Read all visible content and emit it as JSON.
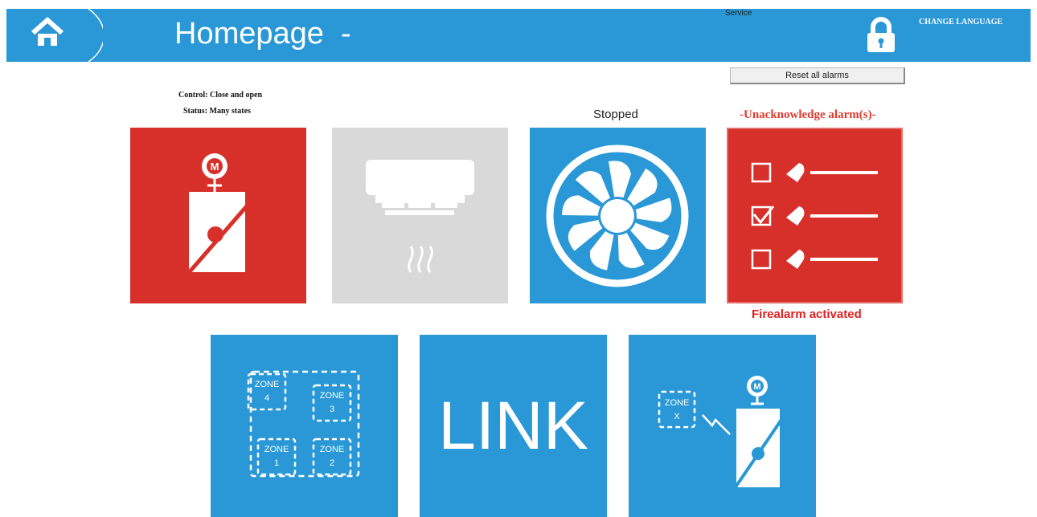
{
  "header": {
    "title": "Homepage  -",
    "service_label": "Service",
    "change_language": "CHANGE LANGUAGE",
    "color": "#2a98d6"
  },
  "toolbar": {
    "reset_alarms": "Reset all alarms"
  },
  "damper": {
    "control_label": "Control:",
    "control_value": "Close and open",
    "status_label": "Status:",
    "status_value": "Many states",
    "motor_letter": "M"
  },
  "fan": {
    "status": "Stopped"
  },
  "alarms": {
    "unacknowledged": "-Unacknowledge alarm(s)-",
    "fire": "Firealarm activated"
  },
  "zones": {
    "labels": [
      "ZONE",
      "ZONE",
      "ZONE",
      "ZONE"
    ],
    "numbers": [
      "4",
      "3",
      "1",
      "2"
    ]
  },
  "link": {
    "label": "LINK"
  },
  "zone_damper": {
    "zone_label": "ZONE",
    "zone_number": "X",
    "motor_letter": "M"
  },
  "colors": {
    "blue": "#2a98d6",
    "red": "#d7302a",
    "grey": "#d9d9d9",
    "alarm_text": "#e03a2e"
  },
  "icons": [
    "home-icon",
    "lock-icon",
    "damper-icon",
    "smoke-detector-icon",
    "fan-icon",
    "alarm-list-icon",
    "zones-icon",
    "zone-damper-icon"
  ]
}
